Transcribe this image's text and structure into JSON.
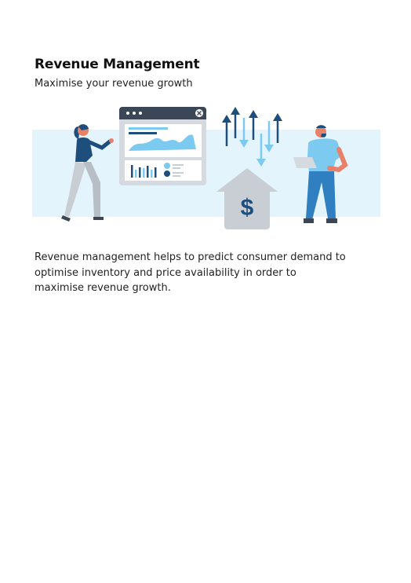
{
  "page": {
    "title": "Revenue Management",
    "subtitle": "Maximise your revenue growth",
    "body": "Revenue management helps to predict consumer demand to optimise inventory and price availability in order to maximise revenue growth."
  },
  "illustration": {
    "currency_symbol": "$",
    "colors": {
      "band": "#e3f4fc",
      "dark_blue": "#1e4e7c",
      "mid_blue": "#2f7fc1",
      "light_blue": "#7ccaf0",
      "grey": "#c9ced4",
      "window_bar": "#3b4756",
      "skin": "#e8816a"
    },
    "icons": [
      "dashboard-window-icon",
      "arrows-icon",
      "house-dollar-icon",
      "woman-figure-icon",
      "man-figure-icon",
      "close-icon"
    ]
  }
}
